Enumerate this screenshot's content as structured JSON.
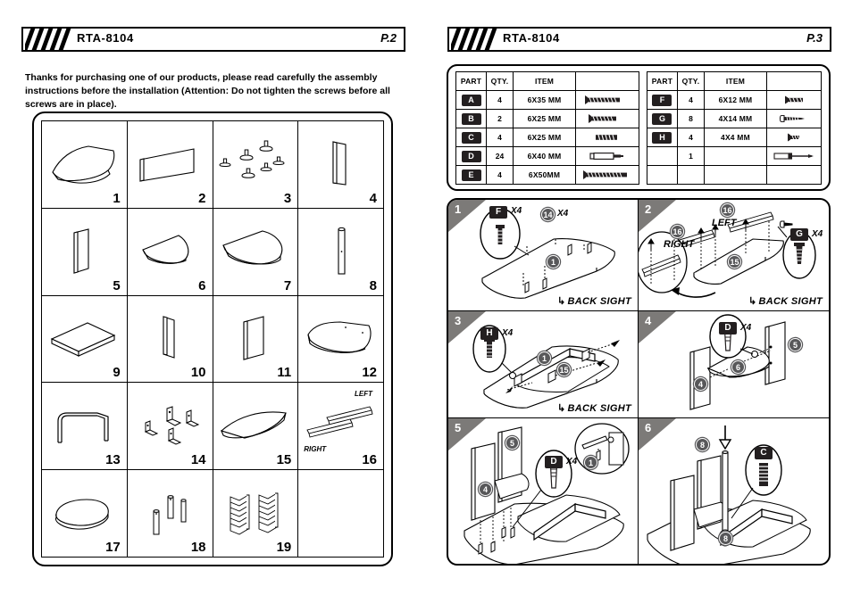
{
  "document": {
    "model": "RTA-8104",
    "type": "assembly-instructions"
  },
  "left_page": {
    "header": {
      "model": "RTA-8104",
      "page_label": "P.2"
    },
    "intro_text": "Thanks for purchasing one of our products, please read carefully the assembly instructions before the installation (Attention: Do not tighten the screws before all screws are in place).",
    "parts": [
      {
        "number": "1",
        "shape": "curved-top-panel"
      },
      {
        "number": "2",
        "shape": "thin-rect-panel"
      },
      {
        "number": "3",
        "shape": "cam-locks-group"
      },
      {
        "number": "4",
        "shape": "tall-side-panel"
      },
      {
        "number": "5",
        "shape": "tall-side-panel"
      },
      {
        "number": "6",
        "shape": "small-rounded-shelf"
      },
      {
        "number": "7",
        "shape": "large-rounded-shelf"
      },
      {
        "number": "8",
        "shape": "vertical-pole"
      },
      {
        "number": "9",
        "shape": "flat-rect-shelf"
      },
      {
        "number": "10",
        "shape": "narrow-vertical-panel"
      },
      {
        "number": "11",
        "shape": "vertical-panel"
      },
      {
        "number": "12",
        "shape": "curved-square-panel"
      },
      {
        "number": "13",
        "shape": "metal-u-frame"
      },
      {
        "number": "14",
        "shape": "corner-brackets-group"
      },
      {
        "number": "15",
        "shape": "curved-shelf"
      },
      {
        "number": "16",
        "shape": "drawer-slides-pair",
        "label_left": "LEFT",
        "label_right": "RIGHT"
      },
      {
        "number": "17",
        "shape": "oval-rounded-panel"
      },
      {
        "number": "18",
        "shape": "three-poles"
      },
      {
        "number": "19",
        "shape": "two-racks"
      }
    ]
  },
  "right_page": {
    "header": {
      "model": "RTA-8104",
      "page_label": "P.3"
    },
    "hardware_table": {
      "columns": [
        "PART",
        "QTY.",
        "ITEM",
        ""
      ],
      "left_rows": [
        {
          "part": "A",
          "qty": "4",
          "item": "6X35 MM",
          "icon": "flat-head-screw-long"
        },
        {
          "part": "B",
          "qty": "2",
          "item": "6X25 MM",
          "icon": "flat-head-screw-medium"
        },
        {
          "part": "C",
          "qty": "4",
          "item": "6X25 MM",
          "icon": "threaded-insert"
        },
        {
          "part": "D",
          "qty": "24",
          "item": "6X40 MM",
          "icon": "cam-bolt"
        },
        {
          "part": "E",
          "qty": "4",
          "item": "6X50MM",
          "icon": "flat-head-screw-extra-long"
        }
      ],
      "right_rows": [
        {
          "part": "F",
          "qty": "4",
          "item": "6X12 MM",
          "icon": "flat-head-screw-short"
        },
        {
          "part": "G",
          "qty": "8",
          "item": "4X14 MM",
          "icon": "pan-head-screw"
        },
        {
          "part": "H",
          "qty": "4",
          "item": "4X4 MM",
          "icon": "stub-screw"
        },
        {
          "part": "",
          "qty": "1",
          "item": "",
          "icon": "screwdriver"
        },
        {
          "part": "",
          "qty": "",
          "item": "",
          "icon": ""
        }
      ]
    },
    "steps": [
      {
        "number": "1",
        "hardware": [
          {
            "part": "F",
            "qty": "X4",
            "icon": "flat-head-screw-short"
          }
        ],
        "part_bubbles": [
          "14",
          "1"
        ],
        "bubble_qty": "X4",
        "note": "BACK SIGHT"
      },
      {
        "number": "2",
        "hardware": [
          {
            "part": "G",
            "qty": "X4",
            "icon": "pan-head-screw"
          }
        ],
        "part_bubbles": [
          "16",
          "16",
          "15"
        ],
        "labels": [
          "LEFT",
          "RIGHT"
        ],
        "note": "BACK SIGHT"
      },
      {
        "number": "3",
        "hardware": [
          {
            "part": "H",
            "qty": "X4",
            "icon": "stub-screw"
          }
        ],
        "part_bubbles": [
          "1",
          "15"
        ],
        "note": "BACK SIGHT"
      },
      {
        "number": "4",
        "hardware": [
          {
            "part": "D",
            "qty": "X4",
            "icon": "cam-bolt"
          }
        ],
        "part_bubbles": [
          "5",
          "6",
          "4"
        ],
        "note": ""
      },
      {
        "number": "5",
        "hardware": [
          {
            "part": "D",
            "qty": "X4",
            "icon": "cam-bolt"
          }
        ],
        "part_bubbles": [
          "5",
          "4",
          "1"
        ],
        "note": ""
      },
      {
        "number": "6",
        "hardware": [
          {
            "part": "C",
            "qty": "",
            "icon": "threaded-insert"
          }
        ],
        "part_bubbles": [
          "8",
          "8"
        ],
        "note": ""
      }
    ]
  }
}
